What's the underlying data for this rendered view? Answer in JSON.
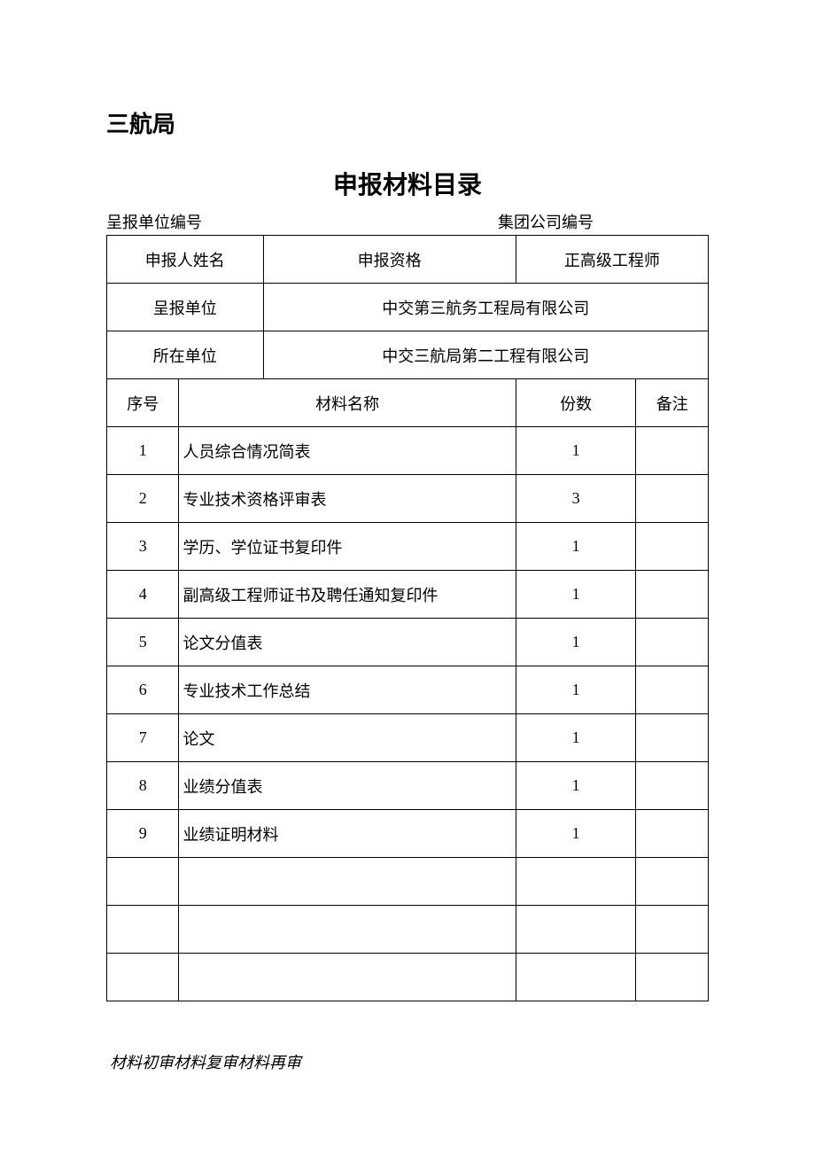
{
  "org_name": "三航局",
  "doc_title": "申报材料目录",
  "codes": {
    "submit_code_label": "呈报单位编号",
    "group_code_label": "集团公司编号"
  },
  "info": {
    "applicant_label": "申报人姓名",
    "qualification_label": "申报资格",
    "qualification_value": "正高级工程师",
    "submit_unit_label": "呈报单位",
    "submit_unit_value": "中交第三航务工程局有限公司",
    "affiliated_unit_label": "所在单位",
    "affiliated_unit_value": "中交三航局第二工程有限公司"
  },
  "columns": {
    "no": "序号",
    "name": "材料名称",
    "copies": "份数",
    "remark": "备注"
  },
  "rows": [
    {
      "no": "1",
      "name": "人员综合情况简表",
      "copies": "1",
      "remark": ""
    },
    {
      "no": "2",
      "name": "专业技术资格评审表",
      "copies": "3",
      "remark": ""
    },
    {
      "no": "3",
      "name": "学历、学位证书复印件",
      "copies": "1",
      "remark": ""
    },
    {
      "no": "4",
      "name": "副高级工程师证书及聘任通知复印件",
      "copies": "1",
      "remark": ""
    },
    {
      "no": "5",
      "name": "论文分值表",
      "copies": "1",
      "remark": ""
    },
    {
      "no": "6",
      "name": "专业技术工作总结",
      "copies": "1",
      "remark": ""
    },
    {
      "no": "7",
      "name": "论文",
      "copies": "1",
      "remark": ""
    },
    {
      "no": "8",
      "name": "业绩分值表",
      "copies": "1",
      "remark": ""
    },
    {
      "no": "9",
      "name": "业绩证明材料",
      "copies": "1",
      "remark": ""
    },
    {
      "no": "",
      "name": "",
      "copies": "",
      "remark": ""
    },
    {
      "no": "",
      "name": "",
      "copies": "",
      "remark": ""
    },
    {
      "no": "",
      "name": "",
      "copies": "",
      "remark": ""
    }
  ],
  "footer": "材料初审材料复审材料再审"
}
